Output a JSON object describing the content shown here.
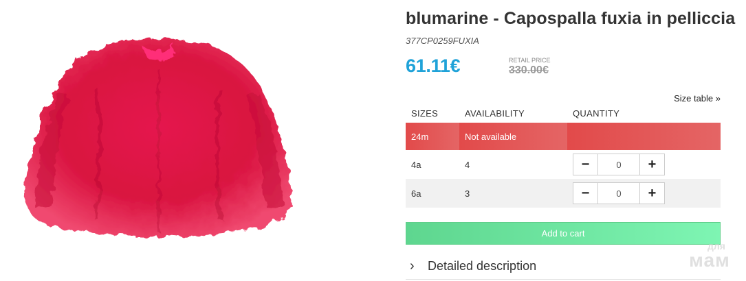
{
  "product": {
    "title": "blumarine - Capospalla fuxia in pelliccia",
    "sku": "377CP0259FUXIA",
    "price": "61.11€",
    "retail_label": "RETAIL PRICE",
    "retail_price": "330.00€",
    "image_icon": "fur-jacket-image",
    "price_color": "#1fa2d8"
  },
  "size_table_link": "Size table »",
  "table": {
    "headers": [
      "SIZES",
      "AVAILABILITY",
      "QUANTITY"
    ],
    "rows": [
      {
        "size": "24m",
        "availability": "Not available",
        "quantity": null
      },
      {
        "size": "4a",
        "availability": "4",
        "quantity": "0"
      },
      {
        "size": "6a",
        "availability": "3",
        "quantity": "0"
      }
    ],
    "minus_symbol": "−",
    "plus_symbol": "+"
  },
  "cart": {
    "label": "Add to cart",
    "color": "#6be0a0"
  },
  "details": {
    "label": "Detailed description",
    "chevron": "›"
  },
  "watermark": {
    "small": "для",
    "big": "мам"
  }
}
